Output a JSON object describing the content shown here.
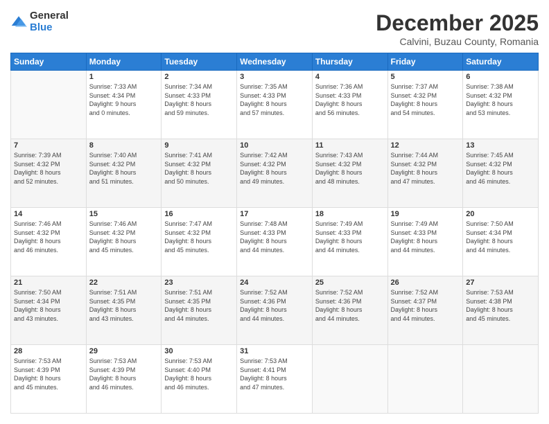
{
  "logo": {
    "general": "General",
    "blue": "Blue"
  },
  "title": "December 2025",
  "subtitle": "Calvini, Buzau County, Romania",
  "days_header": [
    "Sunday",
    "Monday",
    "Tuesday",
    "Wednesday",
    "Thursday",
    "Friday",
    "Saturday"
  ],
  "weeks": [
    [
      {
        "day": "",
        "info": ""
      },
      {
        "day": "1",
        "info": "Sunrise: 7:33 AM\nSunset: 4:34 PM\nDaylight: 9 hours\nand 0 minutes."
      },
      {
        "day": "2",
        "info": "Sunrise: 7:34 AM\nSunset: 4:33 PM\nDaylight: 8 hours\nand 59 minutes."
      },
      {
        "day": "3",
        "info": "Sunrise: 7:35 AM\nSunset: 4:33 PM\nDaylight: 8 hours\nand 57 minutes."
      },
      {
        "day": "4",
        "info": "Sunrise: 7:36 AM\nSunset: 4:33 PM\nDaylight: 8 hours\nand 56 minutes."
      },
      {
        "day": "5",
        "info": "Sunrise: 7:37 AM\nSunset: 4:32 PM\nDaylight: 8 hours\nand 54 minutes."
      },
      {
        "day": "6",
        "info": "Sunrise: 7:38 AM\nSunset: 4:32 PM\nDaylight: 8 hours\nand 53 minutes."
      }
    ],
    [
      {
        "day": "7",
        "info": "Sunrise: 7:39 AM\nSunset: 4:32 PM\nDaylight: 8 hours\nand 52 minutes."
      },
      {
        "day": "8",
        "info": "Sunrise: 7:40 AM\nSunset: 4:32 PM\nDaylight: 8 hours\nand 51 minutes."
      },
      {
        "day": "9",
        "info": "Sunrise: 7:41 AM\nSunset: 4:32 PM\nDaylight: 8 hours\nand 50 minutes."
      },
      {
        "day": "10",
        "info": "Sunrise: 7:42 AM\nSunset: 4:32 PM\nDaylight: 8 hours\nand 49 minutes."
      },
      {
        "day": "11",
        "info": "Sunrise: 7:43 AM\nSunset: 4:32 PM\nDaylight: 8 hours\nand 48 minutes."
      },
      {
        "day": "12",
        "info": "Sunrise: 7:44 AM\nSunset: 4:32 PM\nDaylight: 8 hours\nand 47 minutes."
      },
      {
        "day": "13",
        "info": "Sunrise: 7:45 AM\nSunset: 4:32 PM\nDaylight: 8 hours\nand 46 minutes."
      }
    ],
    [
      {
        "day": "14",
        "info": "Sunrise: 7:46 AM\nSunset: 4:32 PM\nDaylight: 8 hours\nand 46 minutes."
      },
      {
        "day": "15",
        "info": "Sunrise: 7:46 AM\nSunset: 4:32 PM\nDaylight: 8 hours\nand 45 minutes."
      },
      {
        "day": "16",
        "info": "Sunrise: 7:47 AM\nSunset: 4:32 PM\nDaylight: 8 hours\nand 45 minutes."
      },
      {
        "day": "17",
        "info": "Sunrise: 7:48 AM\nSunset: 4:33 PM\nDaylight: 8 hours\nand 44 minutes."
      },
      {
        "day": "18",
        "info": "Sunrise: 7:49 AM\nSunset: 4:33 PM\nDaylight: 8 hours\nand 44 minutes."
      },
      {
        "day": "19",
        "info": "Sunrise: 7:49 AM\nSunset: 4:33 PM\nDaylight: 8 hours\nand 44 minutes."
      },
      {
        "day": "20",
        "info": "Sunrise: 7:50 AM\nSunset: 4:34 PM\nDaylight: 8 hours\nand 44 minutes."
      }
    ],
    [
      {
        "day": "21",
        "info": "Sunrise: 7:50 AM\nSunset: 4:34 PM\nDaylight: 8 hours\nand 43 minutes."
      },
      {
        "day": "22",
        "info": "Sunrise: 7:51 AM\nSunset: 4:35 PM\nDaylight: 8 hours\nand 43 minutes."
      },
      {
        "day": "23",
        "info": "Sunrise: 7:51 AM\nSunset: 4:35 PM\nDaylight: 8 hours\nand 44 minutes."
      },
      {
        "day": "24",
        "info": "Sunrise: 7:52 AM\nSunset: 4:36 PM\nDaylight: 8 hours\nand 44 minutes."
      },
      {
        "day": "25",
        "info": "Sunrise: 7:52 AM\nSunset: 4:36 PM\nDaylight: 8 hours\nand 44 minutes."
      },
      {
        "day": "26",
        "info": "Sunrise: 7:52 AM\nSunset: 4:37 PM\nDaylight: 8 hours\nand 44 minutes."
      },
      {
        "day": "27",
        "info": "Sunrise: 7:53 AM\nSunset: 4:38 PM\nDaylight: 8 hours\nand 45 minutes."
      }
    ],
    [
      {
        "day": "28",
        "info": "Sunrise: 7:53 AM\nSunset: 4:39 PM\nDaylight: 8 hours\nand 45 minutes."
      },
      {
        "day": "29",
        "info": "Sunrise: 7:53 AM\nSunset: 4:39 PM\nDaylight: 8 hours\nand 46 minutes."
      },
      {
        "day": "30",
        "info": "Sunrise: 7:53 AM\nSunset: 4:40 PM\nDaylight: 8 hours\nand 46 minutes."
      },
      {
        "day": "31",
        "info": "Sunrise: 7:53 AM\nSunset: 4:41 PM\nDaylight: 8 hours\nand 47 minutes."
      },
      {
        "day": "",
        "info": ""
      },
      {
        "day": "",
        "info": ""
      },
      {
        "day": "",
        "info": ""
      }
    ]
  ]
}
